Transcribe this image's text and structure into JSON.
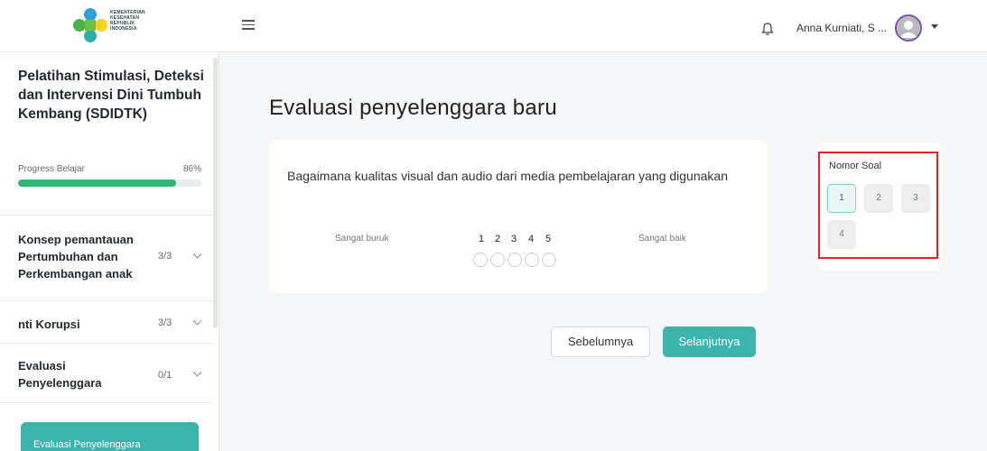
{
  "header": {
    "logo_lines": [
      "KEMENTERIAN",
      "KESEHATAN",
      "REPUBLIK",
      "INDONESIA"
    ],
    "user_name": "Anna Kurniati, S ..."
  },
  "sidebar": {
    "course_title": "Pelatihan Stimulasi, Deteksi dan Intervensi Dini Tumbuh Kembang (SDIDTK)",
    "progress_label": "Progress Belajar",
    "progress_percent": "86%",
    "progress_value": 0.86,
    "modules": [
      {
        "title": "Konsep pemantauan Pertumbuhan dan Perkembangan anak",
        "count": "3/3"
      },
      {
        "title": "nti Korupsi",
        "count": "3/3"
      },
      {
        "title": "Evaluasi Penyelenggara",
        "count": "0/1"
      }
    ],
    "active_button": "Evaluasi Penyelenggara"
  },
  "main": {
    "page_title": "Evaluasi penyelenggara baru",
    "question": "Bagaimana kualitas visual dan audio dari media pembelajaran yang digunakan",
    "scale_min_label": "Sangat buruk",
    "scale_max_label": "Sangat baik",
    "scale": [
      "1",
      "2",
      "3",
      "4",
      "5"
    ],
    "prev_button": "Sebelumnya",
    "next_button": "Selanjutnya"
  },
  "question_nav": {
    "title": "Nomor Soal",
    "numbers": [
      "1",
      "2",
      "3",
      "4"
    ],
    "active": "1"
  },
  "colors": {
    "accent": "#3cb4ac",
    "progress": "#2bb673",
    "highlight_border": "#e0242a"
  }
}
